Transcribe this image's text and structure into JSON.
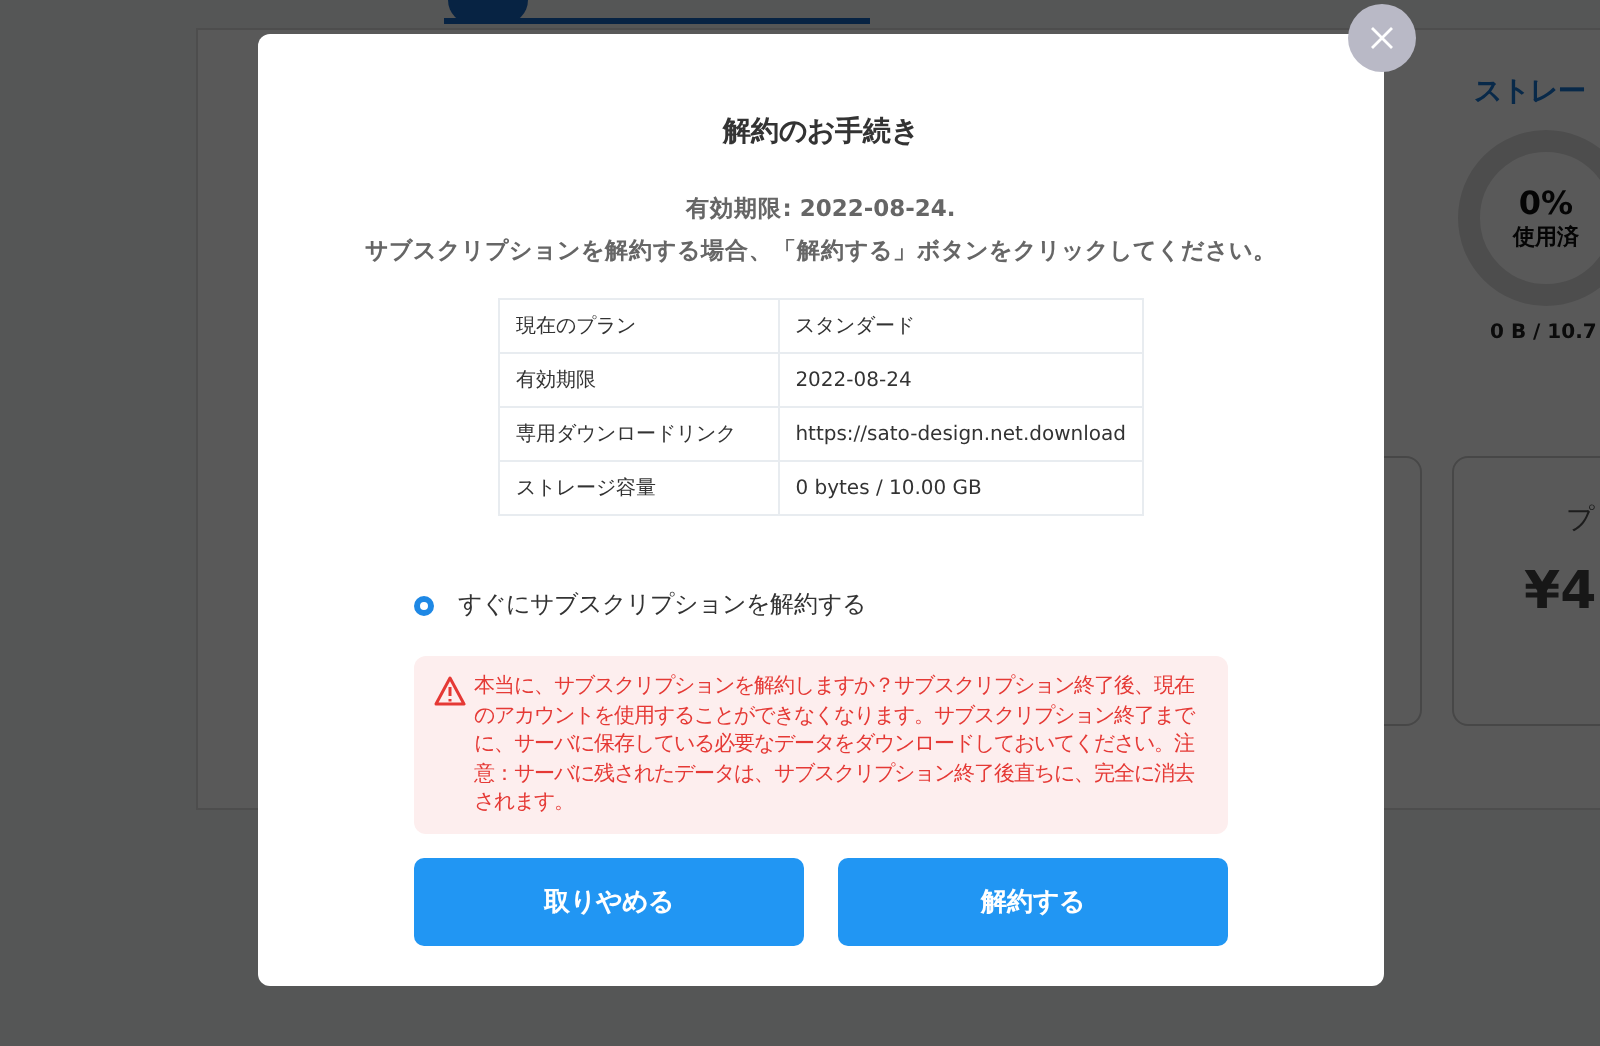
{
  "background_page": {
    "storage": {
      "title": "ストレー",
      "percent": "0%",
      "used_label": "使用済",
      "usage": "0 B / 10.7"
    },
    "plan_card": {
      "name": "プ",
      "price": "¥4"
    }
  },
  "dialog": {
    "title": "解約のお手続き",
    "expiry_line": "有効期限: 2022-08-24.",
    "instruction": "サブスクリプションを解約する場合、「解約する」ボタンをクリックしてください。",
    "details": [
      {
        "label": "現在のプラン",
        "value": "スタンダード"
      },
      {
        "label": "有効期限",
        "value": "2022-08-24"
      },
      {
        "label": "専用ダウンロードリンク",
        "value": "https://sato-design.net.download"
      },
      {
        "label": "ストレージ容量",
        "value": "0 bytes / 10.00 GB"
      }
    ],
    "options": [
      {
        "label": "すぐにサブスクリプションを解約する",
        "selected": true
      }
    ],
    "warning": "本当に、サブスクリプションを解約しますか？サブスクリプション終了後、現在のアカウントを使用することができなくなります。サブスクリプション終了までに、サーバに保存している必要なデータをダウンロードしておいてください。注意：サーバに残されたデータは、サブスクリプション終了後直ちに、完全に消去されます。",
    "buttons": [
      {
        "label": "取りやめる"
      },
      {
        "label": "解約する"
      }
    ]
  }
}
